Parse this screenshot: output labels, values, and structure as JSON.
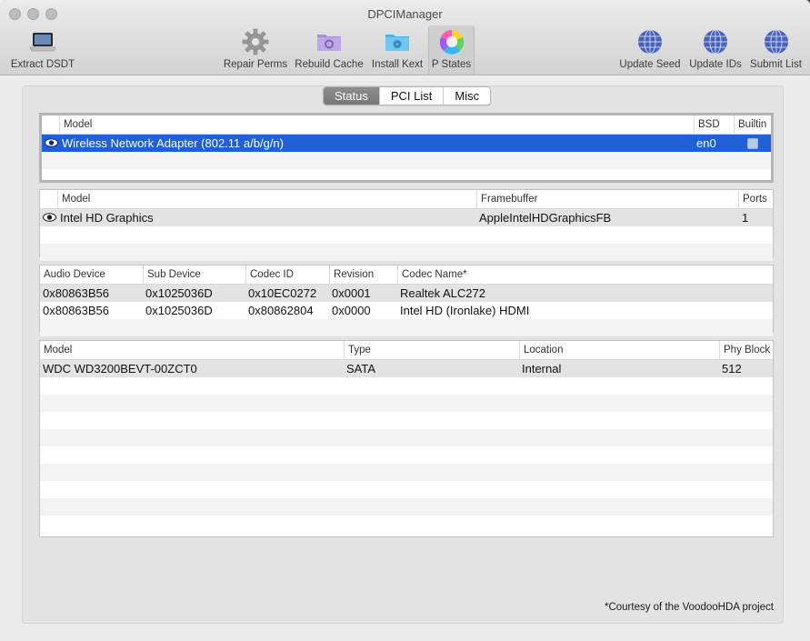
{
  "window": {
    "title": "DPCIManager"
  },
  "toolbar": {
    "extract": {
      "label": "Extract DSDT",
      "icon": "laptop-icon"
    },
    "repair": {
      "label": "Repair Perms",
      "icon": "gear-icon"
    },
    "rebuild": {
      "label": "Rebuild Cache",
      "icon": "folder-gear-icon"
    },
    "install": {
      "label": "Install Kext",
      "icon": "folder-radiation-icon"
    },
    "pstates": {
      "label": "P States",
      "icon": "color-wheel-icon",
      "selected": true
    },
    "update_seed": {
      "label": "Update Seed",
      "icon": "globe-icon"
    },
    "update_ids": {
      "label": "Update IDs",
      "icon": "globe-icon"
    },
    "submit_list": {
      "label": "Submit List",
      "icon": "globe-icon"
    }
  },
  "tabs": {
    "status": "Status",
    "pci_list": "PCI List",
    "misc": "Misc",
    "active": "Status"
  },
  "network": {
    "headers": {
      "model": "Model",
      "bsd": "BSD",
      "builtin": "Builtin"
    },
    "rows": [
      {
        "model": "Wireless Network Adapter (802.11 a/b/g/n)",
        "bsd": "en0",
        "builtin": false,
        "selected": true
      }
    ]
  },
  "graphics": {
    "headers": {
      "model": "Model",
      "framebuffer": "Framebuffer",
      "ports": "Ports"
    },
    "rows": [
      {
        "model": "Intel HD Graphics",
        "framebuffer": "AppleIntelHDGraphicsFB",
        "ports": "1"
      }
    ]
  },
  "audio": {
    "headers": {
      "device": "Audio Device",
      "sub": "Sub Device",
      "codec_id": "Codec ID",
      "revision": "Revision",
      "codec_name": "Codec Name*"
    },
    "rows": [
      {
        "device": "0x80863B56",
        "sub": "0x1025036D",
        "codec_id": "0x10EC0272",
        "revision": "0x0001",
        "codec_name": "Realtek ALC272"
      },
      {
        "device": "0x80863B56",
        "sub": "0x1025036D",
        "codec_id": "0x80862804",
        "revision": "0x0000",
        "codec_name": "Intel HD (Ironlake) HDMI"
      }
    ]
  },
  "storage": {
    "headers": {
      "model": "Model",
      "type": "Type",
      "location": "Location",
      "phy_block": "Phy Block"
    },
    "rows": [
      {
        "model": "WDC WD3200BEVT-00ZCT0",
        "type": "SATA",
        "location": "Internal",
        "phy_block": "512"
      }
    ]
  },
  "footer": {
    "credit": "*Courtesy of the VoodooHDA project"
  },
  "colors": {
    "selection": "#1f5fd8",
    "window_bg": "#ececec"
  }
}
